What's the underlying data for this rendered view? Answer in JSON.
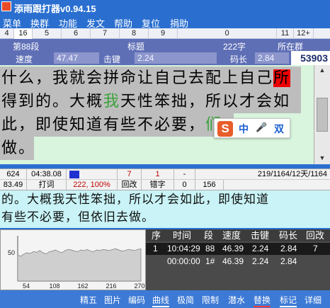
{
  "window": {
    "title": "添雨跟打器v0.94.15"
  },
  "menu": [
    "菜单",
    "换群",
    "功能",
    "发文",
    "帮助",
    "复位",
    "捐助"
  ],
  "ruler": [
    "4",
    "16",
    "5",
    "6",
    "7",
    "8",
    "9",
    "0",
    "11",
    "12+"
  ],
  "info": {
    "segment_label": "第88段",
    "title_label": "标题",
    "chars_label": "222字",
    "group_label": "所在群",
    "speed_label": "速度",
    "speed_value": "47.47",
    "keystroke_label": "击键",
    "keystroke_value": "2.24",
    "code_label": "码长",
    "code_value": "2.84",
    "count_value": "53903"
  },
  "reference": {
    "line1_a": "什么，我就会拼命让自己去配上自己",
    "line1_hl": "所",
    "line2": "得到的。大概",
    "line2_green": "我",
    "line2_b": "天性笨拙，所以才会如",
    "line3": "此，即使知道有些不必要，",
    "line3_tail": "们",
    "line4": "做。"
  },
  "ime": {
    "logo": "S",
    "mode": "中",
    "mic": "🎤",
    "extra": "双"
  },
  "status1": {
    "count": "624",
    "elapsed": "04:38.08",
    "errors": "7",
    "backspace": "1",
    "dash": "-",
    "progress": "219/1164/12天/1164"
  },
  "status2": {
    "speed": "83.49",
    "typing_label": "打词",
    "ratio": "222, 100%",
    "backspace_label": "回改",
    "wrong_label": "错字",
    "zero": "0",
    "num": "156"
  },
  "typed": {
    "line1": "的。大概我天性笨拙，所以才会如此，即使知道",
    "line2": "有些不必要，但依旧去做。"
  },
  "chart_data": {
    "type": "area",
    "x_ticks": [
      "54",
      "108",
      "162",
      "216",
      "270"
    ],
    "y_ticks": [
      "50"
    ],
    "values": [
      46,
      44,
      48,
      50,
      49,
      52,
      51,
      54,
      50,
      48,
      52,
      53,
      55,
      52,
      50,
      54,
      56,
      55,
      53,
      52,
      55,
      54,
      56,
      53,
      52,
      55,
      54,
      56,
      55,
      54,
      56,
      57,
      55,
      53,
      54,
      56,
      55,
      54,
      56,
      57
    ]
  },
  "history": {
    "headers": [
      "序",
      "时间",
      "段",
      "速度",
      "击键",
      "码长",
      "回改"
    ],
    "rows": [
      [
        "1",
        "10:04:29",
        "88",
        "46.39",
        "2.24",
        "2.84",
        "7"
      ],
      [
        "",
        "00:00:00",
        "1#",
        "46.39",
        "2.24",
        "2.84",
        ""
      ]
    ]
  },
  "bottom": [
    "精五",
    "图片",
    "编码",
    "曲线",
    "极简",
    "限制",
    "潜水",
    "替换",
    "标记",
    "详细"
  ],
  "colors": {
    "accent": "#2a6fd0",
    "info_bg": "#5f6fb6",
    "reference_bg": "#d9f5dd",
    "typed_bg": "#c9f3f6",
    "highlight": "#ee0000"
  }
}
